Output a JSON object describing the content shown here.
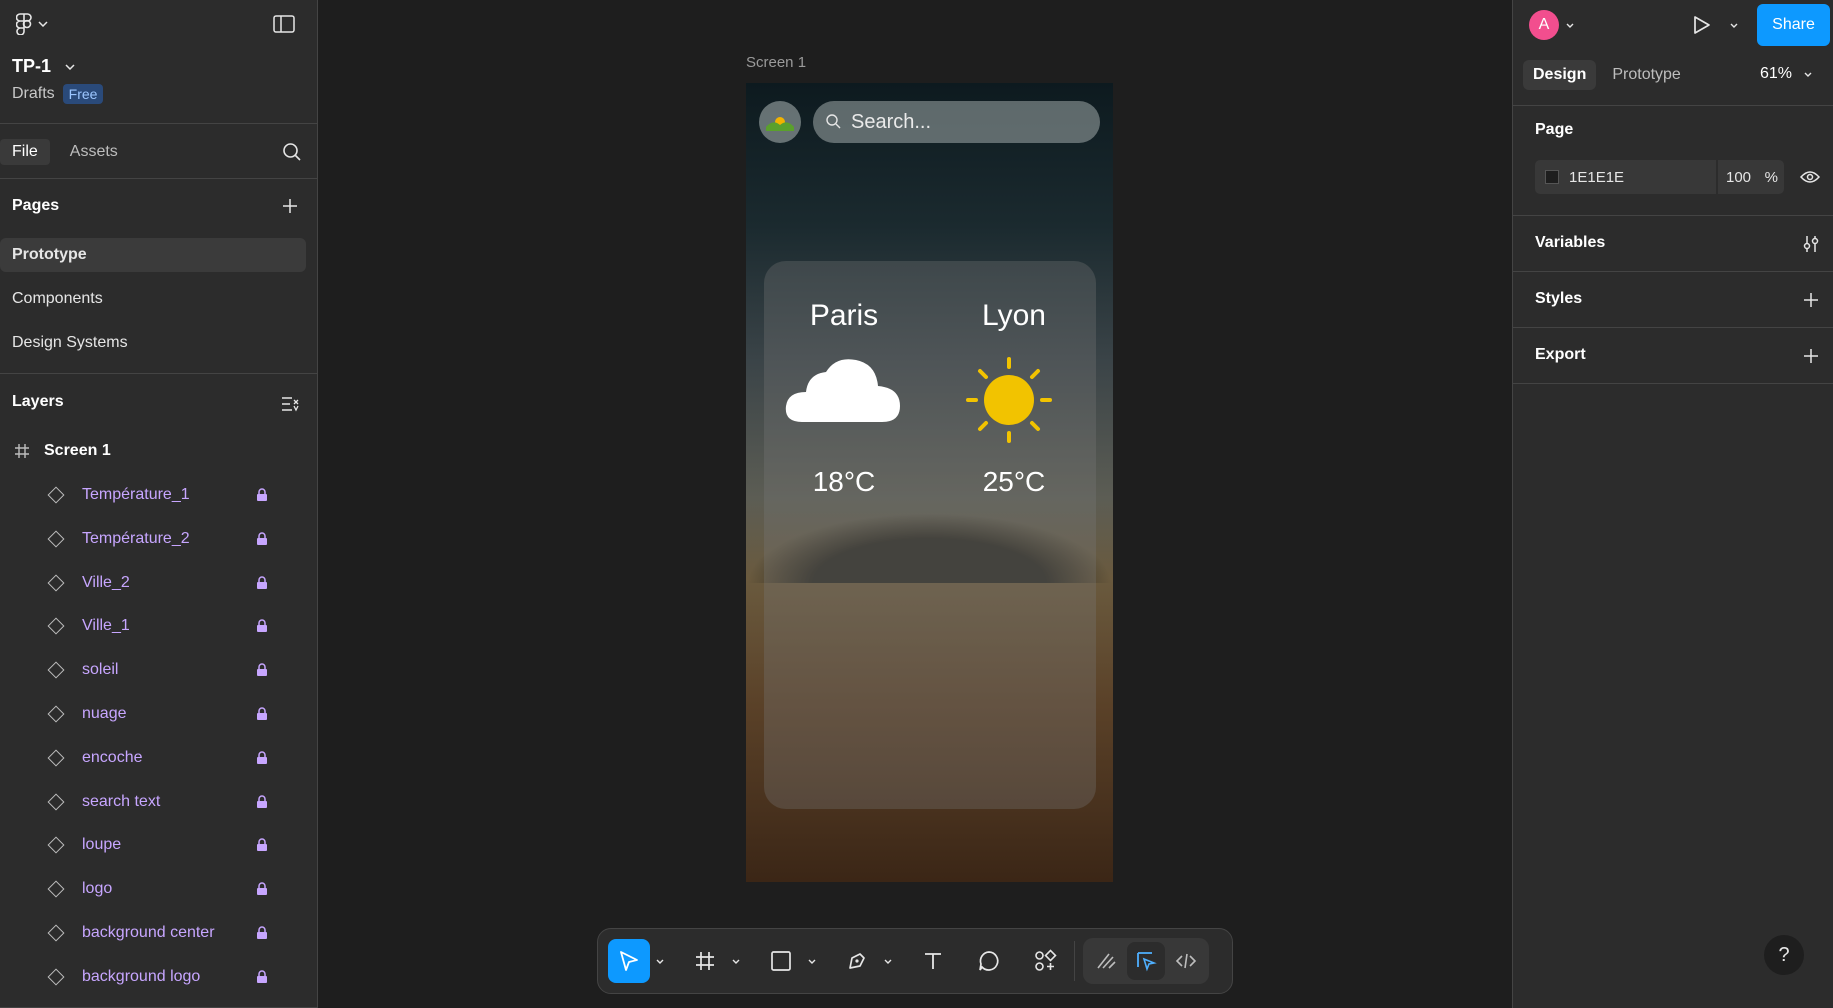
{
  "file": {
    "title": "TP-1",
    "location": "Drafts",
    "plan": "Free"
  },
  "left_tabs": {
    "file": "File",
    "assets": "Assets"
  },
  "pages": {
    "title": "Pages",
    "items": [
      "Prototype",
      "Components",
      "Design Systems"
    ],
    "active": "Prototype"
  },
  "layers": {
    "title": "Layers",
    "frame": "Screen 1",
    "items": [
      "Température_1",
      "Température_2",
      "Ville_2",
      "Ville_1",
      "soleil",
      "nuage",
      "encoche",
      "search text",
      "loupe",
      "logo",
      "background center",
      "background logo"
    ]
  },
  "canvas": {
    "frame_label": "Screen 1",
    "search_placeholder": "Search...",
    "city_1": "Paris",
    "city_2": "Lyon",
    "temp_1": "18°C",
    "temp_2": "25°C",
    "weather_1_icon": "cloud-icon",
    "weather_2_icon": "sun-icon"
  },
  "right": {
    "avatar_initial": "A",
    "share": "Share",
    "tabs": {
      "design": "Design",
      "prototype": "Prototype"
    },
    "zoom": "61%",
    "page_section": "Page",
    "page_color": "1E1E1E",
    "page_opacity": "100",
    "opacity_unit": "%",
    "variables": "Variables",
    "styles": "Styles",
    "export": "Export",
    "help": "?"
  },
  "colors": {
    "accent": "#0d99ff",
    "layer_text": "#c7a6ff",
    "avatar": "#f24e8e",
    "sun": "#f2c300"
  }
}
